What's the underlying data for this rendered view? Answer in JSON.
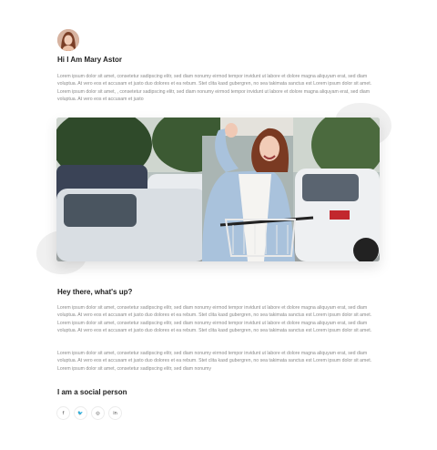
{
  "profile": {
    "greeting": "Hi I Am Mary Astor",
    "intro": "Lorem ipsum dolor sit amet, consetetur sadipscing elitr, sed diam nonumy eirmod tempor invidunt ut labore et dolore magna aliquyam erat, sed diam voluptua. At vero eos et accusam et justo duo dolores et ea rebum. Stet clita kasd gubergren, no sea takimata sanctus est Lorem ipsum dolor sit amet. Lorem ipsum dolor sit amet, , consetetur sadipscing elitr, sed diam nonumy eirmod tempor invidunt ut labore et dolore magna aliquyam erat, sed diam voluptua. At vero eos et accusam et justo"
  },
  "section_whats_up": {
    "title": "Hey there, what's up?",
    "paragraph_1": "Lorem ipsum dolor sit amet, consetetur sadipscing elitr, sed diam nonumy eirmod tempor invidunt ut labore et dolore magna aliquyam erat, sed diam voluptua. At vero eos et accusam et justo duo dolores et ea rebum. Stet clita kasd gubergren, no sea takimata sanctus est Lorem ipsum dolor sit amet. Lorem ipsum dolor sit amet, consetetur sadipscing elitr, sed diam nonumy eirmod tempor invidunt ut labore et dolore magna aliquyam erat, sed diam voluptua. At vero eos et accusam et justo duo dolores et ea rebum. Stet clita kasd gubergren, no sea takimata sanctus est Lorem ipsum dolor sit amet.",
    "paragraph_2": "Lorem ipsum dolor sit amet, consetetur sadipscing elitr, sed diam nonumy eirmod tempor invidunt ut labore et dolore magna aliquyam erat, sed diam voluptua. At vero eos et accusam et justo duo dolores et ea rebum. Stet clita kasd gubergren, no sea takimata sanctus est Lorem ipsum dolor sit amet. Lorem ipsum dolor sit amet, consetetur sadipscing elitr, sed diam nonumy"
  },
  "section_social": {
    "title": "I am a social person",
    "icons": [
      {
        "name": "facebook-icon",
        "glyph": "f"
      },
      {
        "name": "twitter-icon",
        "glyph": "🐦"
      },
      {
        "name": "instagram-icon",
        "glyph": "◎"
      },
      {
        "name": "linkedin-icon",
        "glyph": "in"
      }
    ]
  },
  "colors": {
    "text_heading": "#222222",
    "text_body": "#8a8a8a",
    "blob": "#f0f0f0"
  }
}
